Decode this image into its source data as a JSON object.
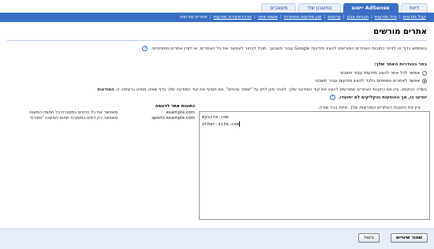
{
  "tabs": [
    {
      "label": "דיווח",
      "active": false
    },
    {
      "label": "AdSense יישום",
      "active": true
    },
    {
      "label": "החשבון שלי",
      "active": false
    },
    {
      "label": "משאבים",
      "active": false
    }
  ],
  "subnav": [
    {
      "label": "קבל מודעות",
      "current": false
    },
    {
      "label": "נהל מודעות",
      "current": false
    },
    {
      "label": "תבניות צבע",
      "current": false
    },
    {
      "label": "ערוצים",
      "current": false
    },
    {
      "label": "סנן מודעות מתחרות",
      "current": false
    },
    {
      "label": "אשות אתר",
      "current": false
    },
    {
      "label": "מרכז סקירת מודעות",
      "current": false
    },
    {
      "label": "אתרים מורשים",
      "current": true
    }
  ],
  "page": {
    "title": "אתרים מורשים",
    "intro": "השתמש בדף זה לזיהוי כתובות האתרים המורשים להציג מודעות Google עבור חשבונך. תוכל לבחור לאפשר את כל האתרים, או לציין אתרים ספציפיים.",
    "choose_label": "בחר בהגדרות האתר שלך:",
    "option_all": "אפשר לכל אתר להציג מודעות עבור חשבוני",
    "option_specific": "אפשר לאתרים מסוימים בלבד להציג מודעות עבור חשבוני",
    "desc_line1_pre": "בשדה הטקסט, ציין את כתובות האתרים שמורשים להציג את קוד המודעה שלך. לאחר מכן לחץ על \"שמור שינויים\". אם תוסיף את קוד המודעה שלך בדף שאינו מופיע ברשימה זו,",
    "desc_line1_bold": "המודעות",
    "desc_line2": "יופיעו בו, אך ההופעות והקליקים לא יתועדו.",
    "enter_label": "ציין את כתובות האתרים המורשות שלך. אחת בכל שורה:"
  },
  "urls_textarea": [
    "mysite.com",
    "other-site.com"
  ],
  "examples": {
    "header": "כתובות אתר לדוגמה",
    "rows": [
      {
        "url": "example.com",
        "desc": "מאפשר את כל הדפים במסגרת כל תחומי-המשנה"
      },
      {
        "url": "sports.example.com",
        "desc": "מאפשר רק דפים במסגרת תחום-המשנה 'ספורט'"
      }
    ]
  },
  "buttons": {
    "save": "שמור שינויים",
    "cancel": "ביטול"
  },
  "icons": {
    "info": "info-icon"
  },
  "colors": {
    "accent": "#3b6fc4",
    "footer_bg": "#e8eef8"
  }
}
